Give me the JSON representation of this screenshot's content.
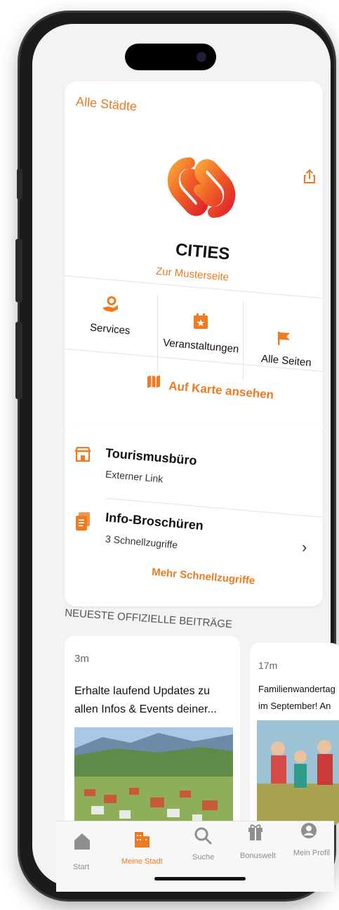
{
  "header": {
    "all_cities": "Alle Städte"
  },
  "city": {
    "name": "CITIES",
    "link": "Zur Musterseite"
  },
  "actions": [
    {
      "label": "Services",
      "icon": "hand-gear-icon"
    },
    {
      "label": "Veranstaltungen",
      "icon": "calendar-star-icon"
    },
    {
      "label": "Alle Seiten",
      "icon": "flag-icon"
    }
  ],
  "map_link": "Auf Karte ansehen",
  "quick_links": [
    {
      "title": "Tourismusbüro",
      "subtitle": "Externer Link",
      "icon": "store-icon"
    },
    {
      "title": "Info-Broschüren",
      "subtitle": "3 Schnellzugriffe",
      "icon": "brochure-icon"
    }
  ],
  "more_quick": "Mehr Schnellzugriffe",
  "section_title": "NEUESTE OFFIZIELLE BEITRÄGE",
  "posts": [
    {
      "time": "3m",
      "line1": "Erhalte laufend Updates zu",
      "line2": "allen Infos & Events deiner..."
    },
    {
      "time": "17m",
      "line1": "Familienwandertag",
      "line2": "im September! An"
    }
  ],
  "tabs": [
    {
      "label": "Start",
      "icon": "home-icon"
    },
    {
      "label": "Meine Stadt",
      "icon": "city-icon"
    },
    {
      "label": "Suche",
      "icon": "search-icon"
    },
    {
      "label": "Bonuswelt",
      "icon": "gift-icon"
    },
    {
      "label": "Mein Profil",
      "icon": "profile-icon"
    }
  ],
  "colors": {
    "accent": "#ef7a1f",
    "inactive": "#8e8e93"
  }
}
